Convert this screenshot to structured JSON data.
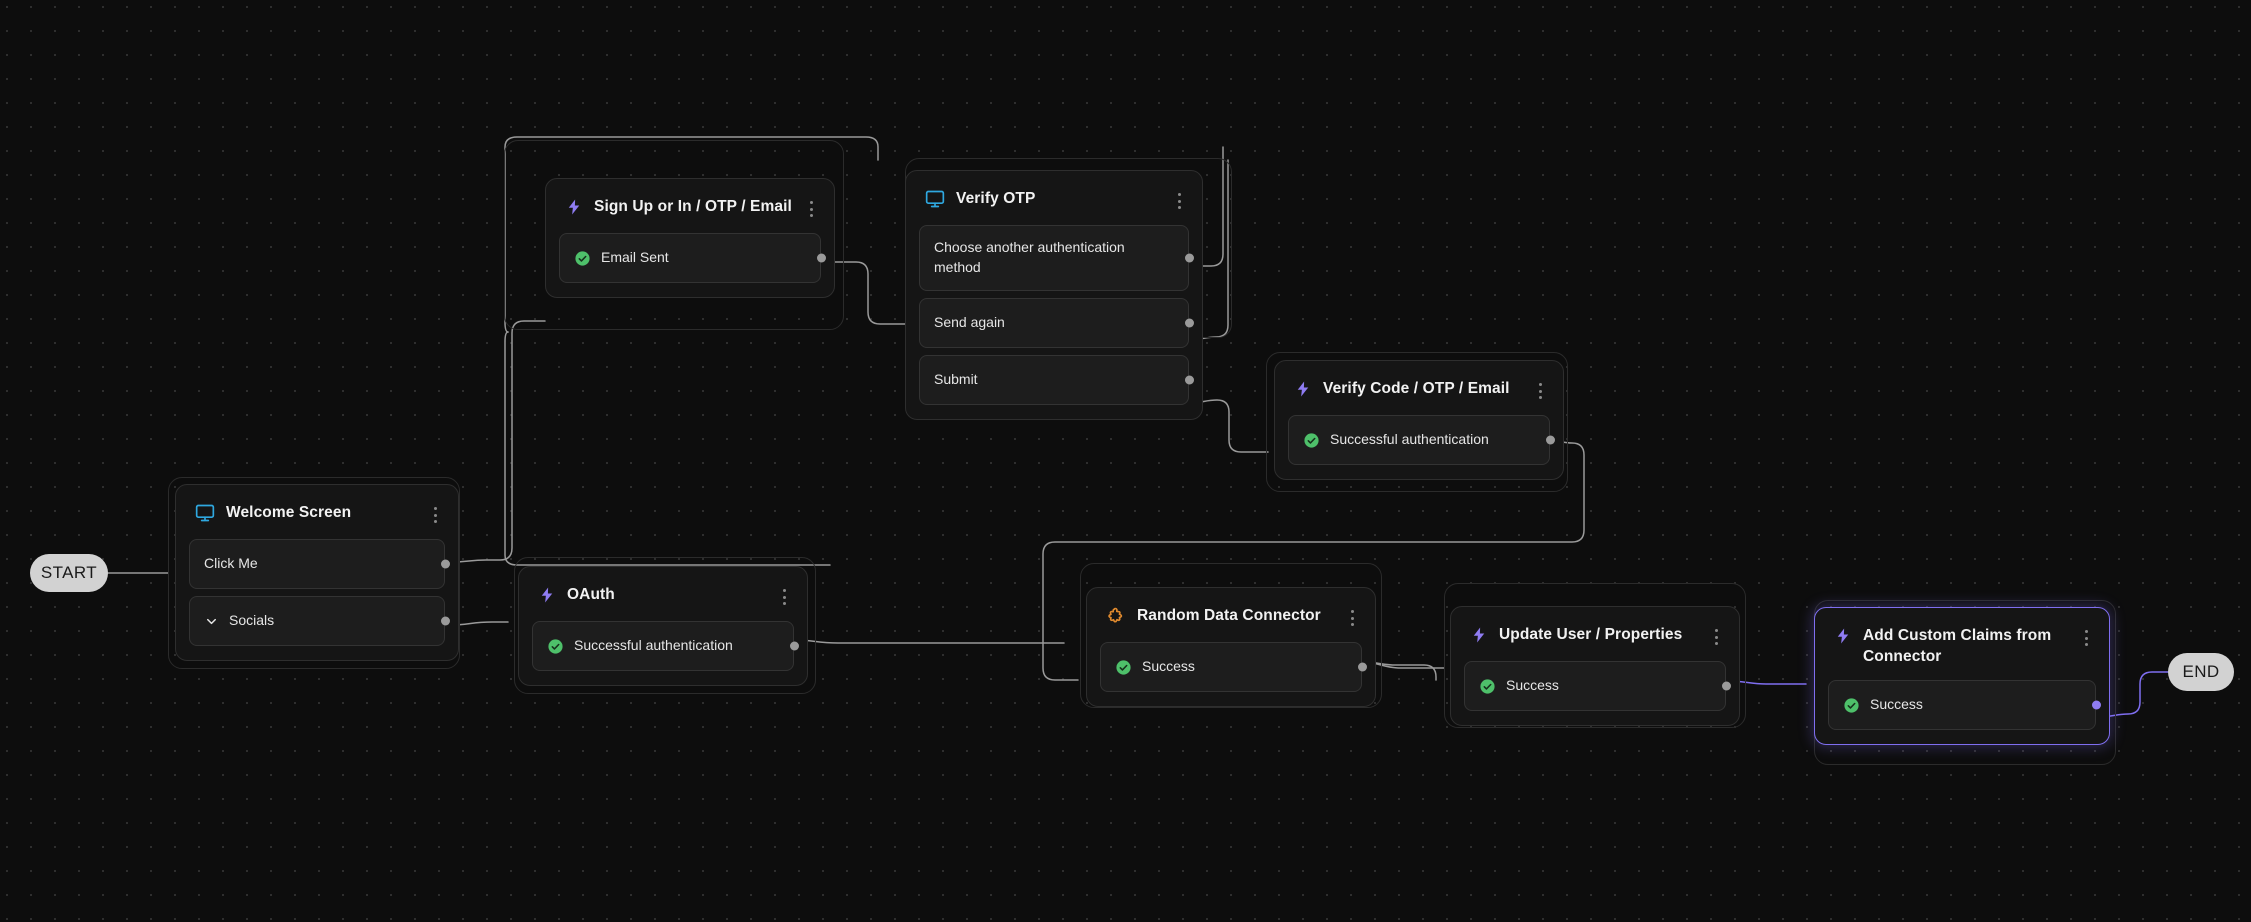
{
  "canvas": {
    "background_color": "#0d0d0d",
    "grid_dot_color": "#2e2e2e",
    "edge_color": "#9a9a9a",
    "accent_color": "#7f6ef0",
    "success_color": "#4ec06a",
    "connector_color": "#e08a2e",
    "screen_icon_color": "#2fa8e0"
  },
  "terminals": {
    "start": "START",
    "end": "END"
  },
  "nodes": [
    {
      "id": "welcome-screen",
      "title": "Welcome Screen",
      "icon": "screen-icon",
      "selected": false,
      "handles": [
        {
          "label": "Click Me",
          "icon": "none"
        },
        {
          "label": "Socials",
          "icon": "chevron-down-icon"
        }
      ]
    },
    {
      "id": "sign-up-or-in",
      "title": "Sign Up or In / OTP / Email",
      "icon": "bolt-icon",
      "selected": false,
      "handles": [
        {
          "label": "Email Sent",
          "icon": "check-circle-icon"
        }
      ]
    },
    {
      "id": "verify-otp",
      "title": "Verify OTP",
      "icon": "screen-icon",
      "selected": false,
      "handles": [
        {
          "label": "Choose another authentication method",
          "icon": "none"
        },
        {
          "label": "Send again",
          "icon": "none"
        },
        {
          "label": "Submit",
          "icon": "none"
        }
      ]
    },
    {
      "id": "verify-code",
      "title": "Verify Code / OTP / Email",
      "icon": "bolt-icon",
      "selected": false,
      "handles": [
        {
          "label": "Successful authentication",
          "icon": "check-circle-icon"
        }
      ]
    },
    {
      "id": "oauth",
      "title": "OAuth",
      "icon": "bolt-icon",
      "selected": false,
      "handles": [
        {
          "label": "Successful authentication",
          "icon": "check-circle-icon"
        }
      ]
    },
    {
      "id": "random-data-connector",
      "title": "Random Data Connector",
      "icon": "puzzle-icon",
      "selected": false,
      "handles": [
        {
          "label": "Success",
          "icon": "check-circle-icon"
        }
      ]
    },
    {
      "id": "update-user",
      "title": "Update User / Properties",
      "icon": "bolt-icon",
      "selected": false,
      "handles": [
        {
          "label": "Success",
          "icon": "check-circle-icon"
        }
      ]
    },
    {
      "id": "add-custom-claims",
      "title": "Add Custom Claims from Connector",
      "icon": "bolt-icon",
      "selected": true,
      "handles": [
        {
          "label": "Success",
          "icon": "check-circle-icon"
        }
      ]
    }
  ]
}
